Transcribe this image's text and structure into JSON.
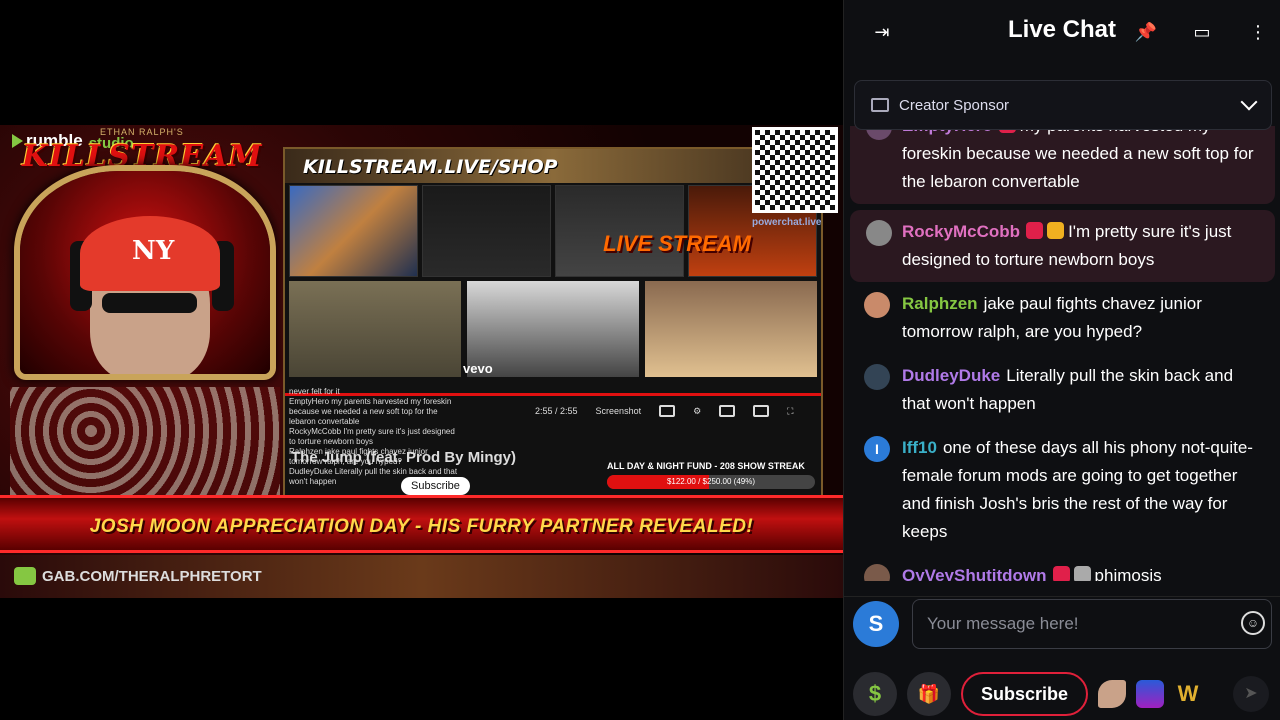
{
  "stream": {
    "rumble_label": "rumble",
    "studio_label": "studio",
    "ethan_label": "ETHAN RALPH'S",
    "killstream_logo": "KILLSTREAM",
    "shop_text": "KILLSTREAM.LIVE/SHOP",
    "live_stream_text": "LIVE STREAM",
    "vevo_label": "vevo",
    "mini_chat": [
      "never felt for it",
      "EmptyHero my parents harvested my foreskin because we needed a new soft top for the lebaron convertable",
      "RockyMcCobb I'm pretty sure it's just designed to torture newborn boys",
      "Ralphzen jake paul fights chavez junior tomorrow ralph, are you hyped?",
      "DudleyDuke Literally pull the skin back and that won't happen"
    ],
    "player_time": "2:55 / 2:55",
    "screenshot_label": "Screenshot",
    "song_title": "The Jump (feat. Prod By Mingy)",
    "subscribe_mini": "Subscribe",
    "fund_label": "ALL DAY & NIGHT FUND - 208 SHOW STREAK",
    "fund_progress_text": "$122.00 / $250.00 (49%)",
    "fund_progress": 0.49,
    "powerchat_label": "powerchat.live",
    "ticker_text": "JOSH MOON APPRECIATION DAY - HIS FURRY PARTNER REVEALED!",
    "gab_text": "GAB.COM/THERALPHRETORT"
  },
  "chat": {
    "title": "Live Chat",
    "icons": {
      "exit": "exit-icon",
      "pin": "pin-icon",
      "toggle": "toggle-icon",
      "more": "more-icon"
    },
    "sponsor_label": "Creator Sponsor",
    "messages": [
      {
        "username": "EmptyHero",
        "color": "#c07ad8",
        "badges": [
          "red"
        ],
        "text": "my parents harvested my foreskin because we needed a new soft top for the lebaron convertable",
        "highlight": true,
        "avatar": "#6a4a6a"
      },
      {
        "username": "RockyMcCobb",
        "color": "#e070c0",
        "badges": [
          "red",
          "gold"
        ],
        "text": "I'm pretty sure it's just designed to torture newborn boys",
        "highlight": true,
        "avatar": "#888"
      },
      {
        "username": "Ralphzen",
        "color": "#85c742",
        "badges": [],
        "text": "jake paul fights chavez junior tomorrow ralph, are you hyped?",
        "highlight": false,
        "avatar": "#c98a6a"
      },
      {
        "username": "DudleyDuke",
        "color": "#b07ae8",
        "badges": [],
        "text": "Literally pull the skin back and that won't happen",
        "highlight": false,
        "avatar": "#334455"
      },
      {
        "username": "Iff10",
        "color": "#3ab0c8",
        "badges": [],
        "text": "one of these days all his phony not-quite-female forum mods are going to get together and finish Josh's bris the rest of the way for keeps",
        "highlight": false,
        "avatar": "#2b7bd8",
        "avatar_letter": "I"
      },
      {
        "username": "OyVeyShutitdown",
        "color": "#b07ae8",
        "badges": [
          "red",
          "gray"
        ],
        "text": "phimosis",
        "highlight": false,
        "avatar": "#7a5a4a"
      }
    ],
    "user_initial": "S",
    "input_placeholder": "Your message here!",
    "subscribe_label": "Subscribe",
    "dollar_symbol": "$",
    "emote_w": "W"
  },
  "colors": {
    "accent_red": "#e0203a",
    "rumble_green": "#85c742"
  }
}
